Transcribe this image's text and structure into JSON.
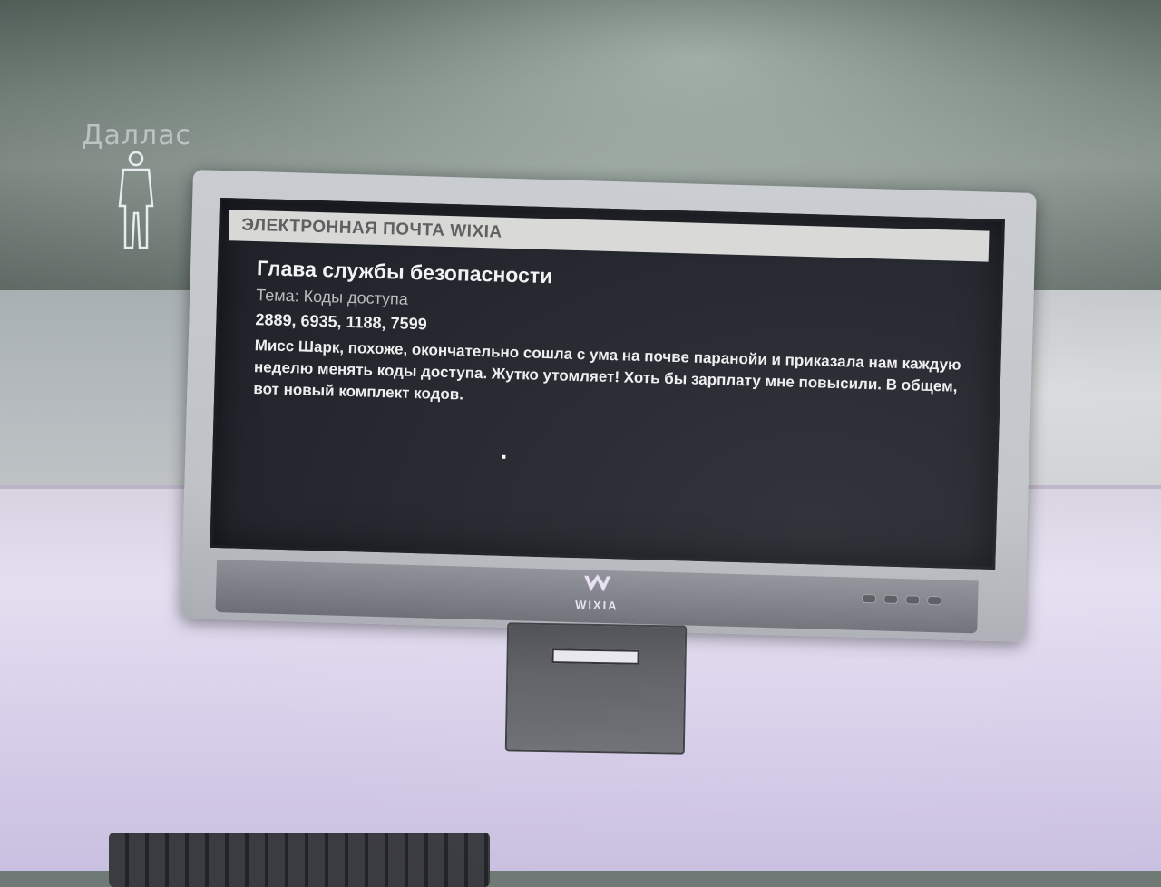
{
  "scene": {
    "npc": {
      "name": "Даллас",
      "icon": "person-silhouette-icon"
    },
    "monitor": {
      "brand": "WIXIA",
      "brand_icon": "wixia-logo-icon"
    }
  },
  "email": {
    "window_title": "ЭЛЕКТРОННАЯ ПОЧТА WIXIA",
    "sender": "Глава службы безопасности",
    "subject": "Тема: Коды доступа",
    "codes": "2889, 6935, 1188, 7599",
    "body": "Мисс Шарк, похоже, окончательно сошла с ума на почве паранойи и приказала нам каждую неделю менять коды доступа. Жутко утомляет! Хоть бы зарплату мне повысили. В общем, вот новый комплект кодов."
  },
  "colors": {
    "screen_bg": "#20232a",
    "header_bg": "#d8d9d6",
    "text": "#e7e8ea"
  }
}
